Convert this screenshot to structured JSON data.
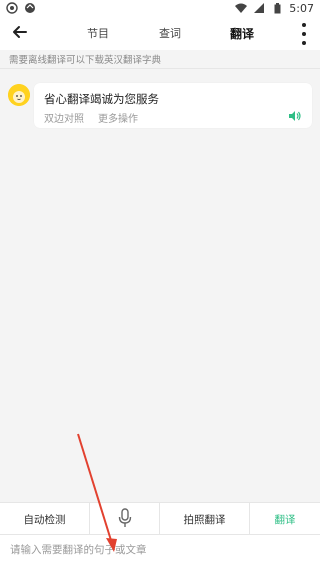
{
  "status_bar": {
    "time": "5:07"
  },
  "header": {
    "tabs": [
      {
        "label": "节目"
      },
      {
        "label": "查词"
      },
      {
        "label": "翻译"
      }
    ],
    "active_tab_index": 2
  },
  "hint_text": "需要离线翻译可以下载英汉翻译字典",
  "message": {
    "text": "省心翻译竭诚为您服务",
    "actions": [
      "双边对照",
      "更多操作"
    ]
  },
  "bottom_bar": {
    "auto_detect_label": "自动检测",
    "photo_translate_label": "拍照翻译",
    "translate_label": "翻译"
  },
  "input": {
    "placeholder": "请输入需要翻译的句子或文章",
    "value": ""
  },
  "colors": {
    "accent": "#2fbf86",
    "annotation_arrow": "#e2412f"
  },
  "icons": [
    "back-arrow-icon",
    "more-vertical-icon",
    "microphone-icon",
    "speaker-icon",
    "wifi-icon",
    "battery-icon",
    "signal-icon"
  ]
}
